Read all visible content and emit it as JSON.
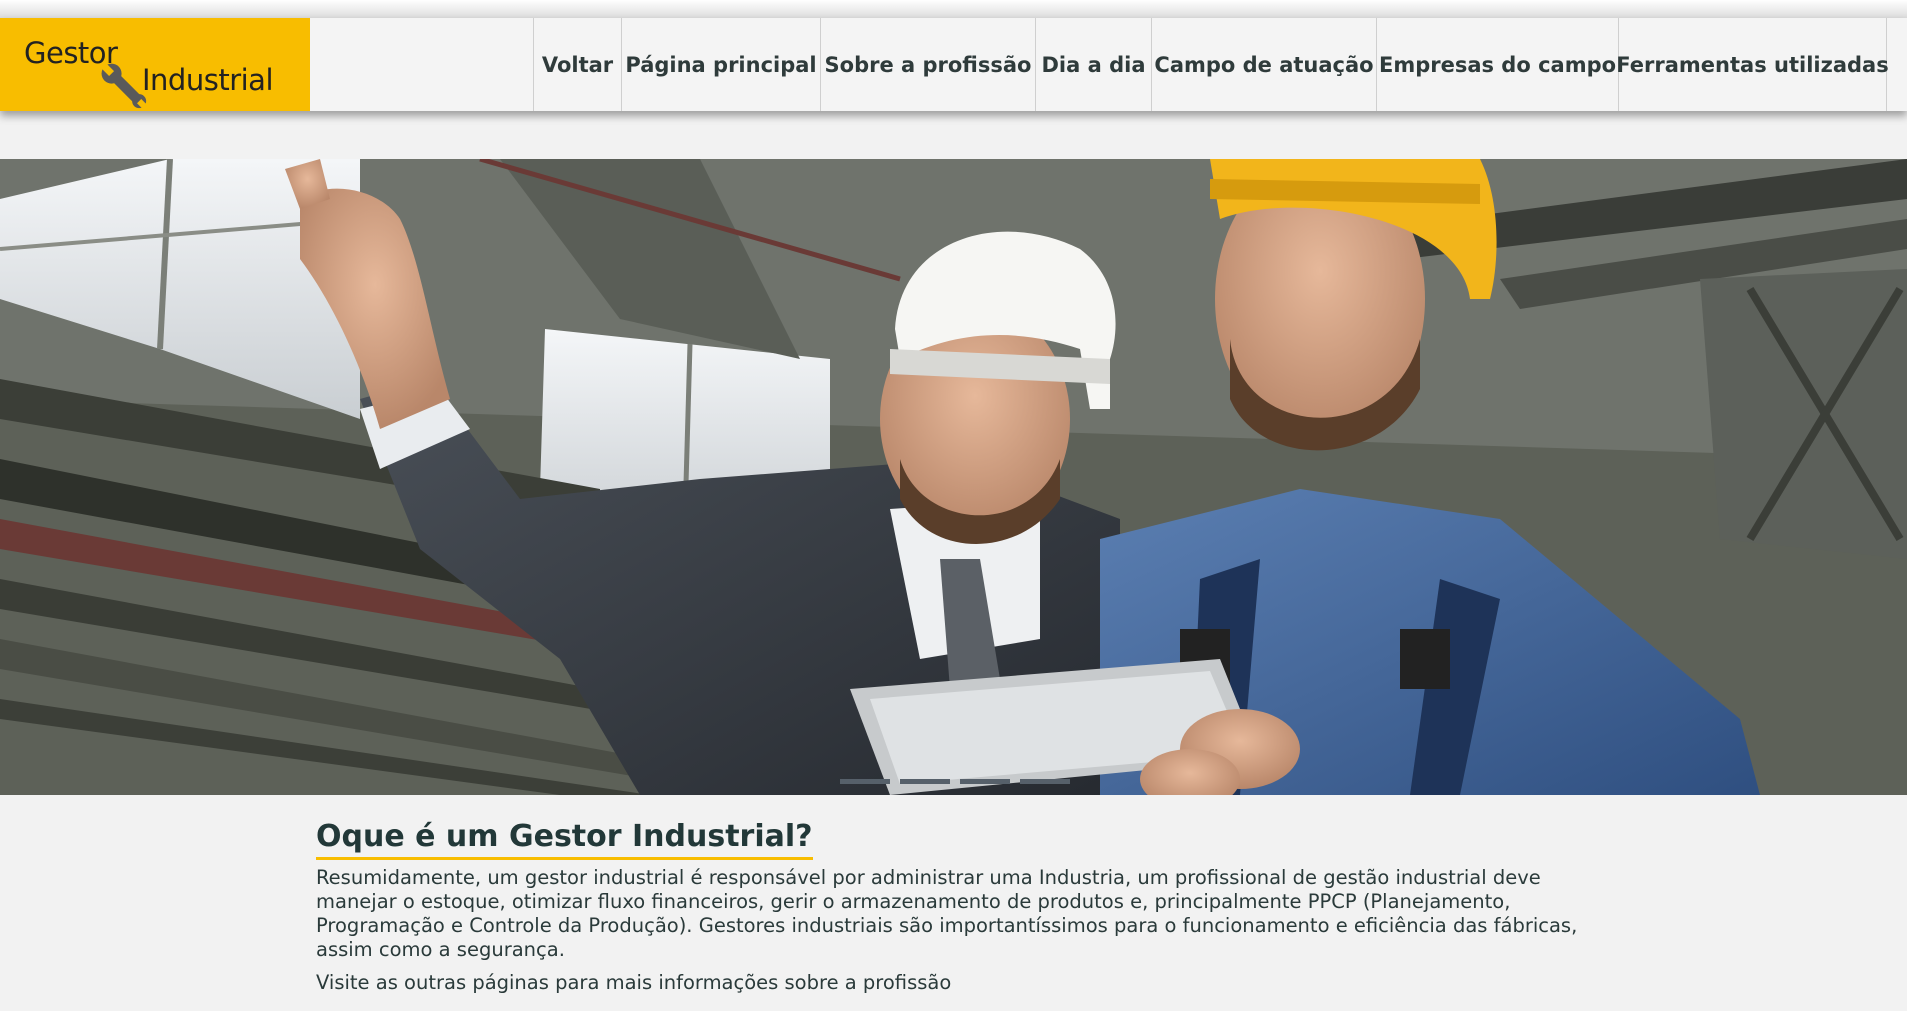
{
  "logo": {
    "line1": "Gestor",
    "line2": "Industrial",
    "icon": "wrench-icon"
  },
  "nav": {
    "items": [
      {
        "label": "Voltar"
      },
      {
        "label": "Página principal"
      },
      {
        "label": "Sobre a profissão"
      },
      {
        "label": "Dia a dia"
      },
      {
        "label": "Campo de atuação"
      },
      {
        "label": "Empresas do campo"
      },
      {
        "label": "Ferramentas utilizadas"
      }
    ]
  },
  "hero": {
    "image": "hero-photo-engineers-in-factory"
  },
  "main": {
    "title": "Oque é um Gestor Industrial?",
    "paragraph1": "Resumidamente, um gestor industrial é responsável por administrar uma Industria, um profissional de gestão industrial deve manejar o estoque, otimizar fluxo financeiros, gerir o armazenamento de produtos e, principalmente PPCP (Planejamento, Programação e Controle da Produção). Gestores industriais são importantíssimos para o funcionamento e eficiência das fábricas, assim como a segurança.",
    "paragraph2": "Visite as outras páginas para mais informações sobre a profissão"
  },
  "colors": {
    "brand": "#f8bd00",
    "nav_bg": "#f4f4f4",
    "text": "#2f3b3b",
    "page_bg": "#f2f2f2"
  }
}
